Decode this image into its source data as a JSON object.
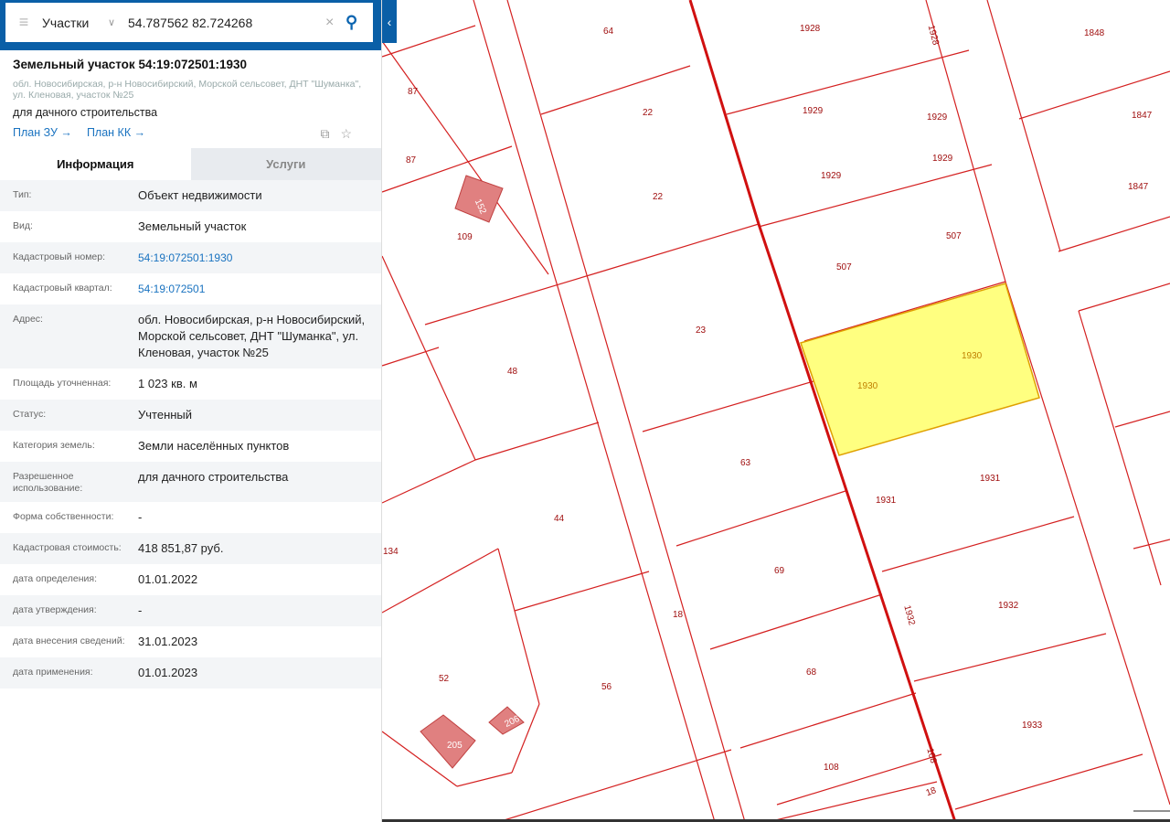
{
  "search": {
    "layer": "Участки",
    "query": "54.787562 82.724268"
  },
  "object": {
    "title": "Земельный участок 54:19:072501:1930",
    "address": "обл. Новосибирская, р-н Новосибирский, Морской сельсовет, ДНТ \"Шуманка\", ул. Кленовая, участок №25",
    "use": "для дачного строительства",
    "links": [
      "План ЗУ →",
      "План КК →"
    ]
  },
  "tabs": [
    "Информация",
    "Услуги"
  ],
  "info": [
    {
      "k": "Тип:",
      "v": "Объект недвижимости"
    },
    {
      "k": "Вид:",
      "v": "Земельный участок"
    },
    {
      "k": "Кадастровый номер:",
      "v": "54:19:072501:1930"
    },
    {
      "k": "Кадастровый квартал:",
      "v": "54:19:072501"
    },
    {
      "k": "Адрес:",
      "v": "обл. Новосибирская, р-н Новосибирский, Морской сельсовет, ДНТ \"Шуманка\", ул. Кленовая, участок №25"
    },
    {
      "k": "Площадь уточненная:",
      "v": "1 023 кв. м"
    },
    {
      "k": "Статус:",
      "v": "Учтенный"
    },
    {
      "k": "Категория земель:",
      "v": "Земли населённых пунктов"
    },
    {
      "k": "Разрешенное использование:",
      "v": "для дачного строительства"
    },
    {
      "k": "Форма собственности:",
      "v": "-"
    },
    {
      "k": "Кадастровая стоимость:",
      "v": "418 851,87 руб."
    },
    {
      "k": "дата определения:",
      "v": "01.01.2022"
    },
    {
      "k": "дата утверждения:",
      "v": "-"
    },
    {
      "k": "дата внесения сведений:",
      "v": "31.01.2023"
    },
    {
      "k": "дата применения:",
      "v": "01.01.2023"
    }
  ],
  "map_labels": [
    "64",
    "1928",
    "1928",
    "1848",
    "87",
    "22",
    "1929",
    "1929",
    "1847",
    "87",
    "1929",
    "1929",
    "22",
    "1847",
    "152",
    "109",
    "507",
    "507",
    "23",
    "1930",
    "1930",
    "48",
    "63",
    "1931",
    "1931",
    "44",
    "134",
    "69",
    "1932",
    "1932",
    "18",
    "68",
    "52",
    "56",
    "1933",
    "206",
    "205",
    "108",
    "108",
    "18"
  ],
  "colors": {
    "accent": "#0a5fa7",
    "parcel": "#d01010",
    "selected": "#ffff80"
  }
}
